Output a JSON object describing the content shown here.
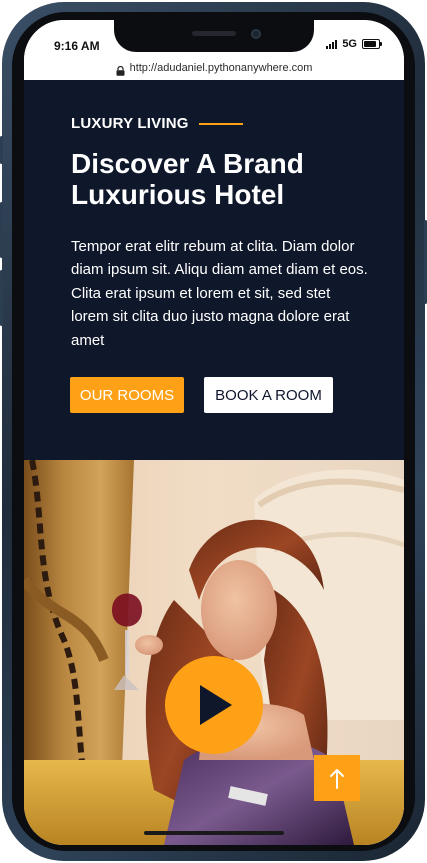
{
  "status_bar": {
    "time": "9:16 AM",
    "network": "5G",
    "icons": [
      "signal-icon",
      "battery-icon"
    ]
  },
  "browser": {
    "url": "http://adudaniel.pythonanywhere.com",
    "icons": [
      "lock-icon"
    ]
  },
  "hero": {
    "eyebrow": "LUXURY LIVING",
    "headline": "Discover A Brand Luxurious Hotel",
    "body": "Tempor erat elitr rebum at clita. Diam dolor diam ipsum sit. Aliqu diam amet diam et eos. Clita erat ipsum et lorem et sit, sed stet lorem sit clita duo justo magna dolore erat amet",
    "primary_button": "OUR ROOMS",
    "secondary_button": "BOOK A ROOM"
  },
  "media": {
    "icons": [
      "play-icon",
      "arrow-up-icon"
    ]
  },
  "colors": {
    "accent": "#FEA116",
    "hero_background": "#0F172B",
    "text_light": "#FFFFFF"
  }
}
